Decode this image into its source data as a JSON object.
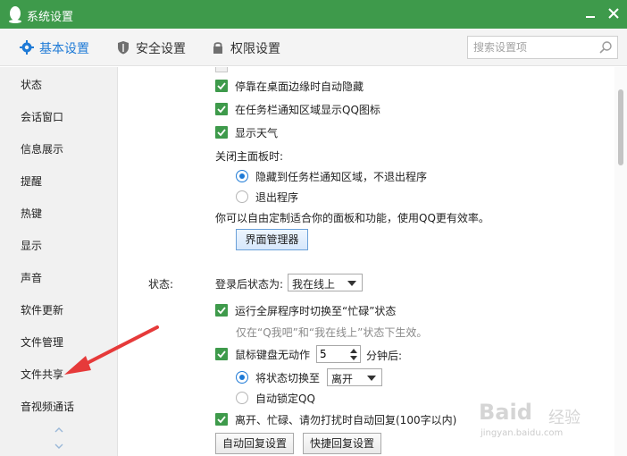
{
  "window": {
    "title": "系统设置"
  },
  "tabs": [
    {
      "label": "基本设置",
      "icon": "gear-icon",
      "active": true
    },
    {
      "label": "安全设置",
      "icon": "shield-icon",
      "active": false
    },
    {
      "label": "权限设置",
      "icon": "lock-icon",
      "active": false
    }
  ],
  "search": {
    "placeholder": "搜索设置项"
  },
  "sidebar": {
    "items": [
      {
        "label": "状态"
      },
      {
        "label": "会话窗口"
      },
      {
        "label": "信息展示"
      },
      {
        "label": "提醒"
      },
      {
        "label": "热键"
      },
      {
        "label": "显示"
      },
      {
        "label": "声音"
      },
      {
        "label": "软件更新"
      },
      {
        "label": "文件管理"
      },
      {
        "label": "文件共享"
      },
      {
        "label": "音视频通话"
      }
    ]
  },
  "panel": {
    "auto_hide": "停靠在桌面边缘时自动隐藏",
    "tray_icon": "在任务栏通知区域显示QQ图标",
    "show_weather": "显示天气",
    "close_panel_label": "关闭主面板时:",
    "close_opt_hide": "隐藏到任务栏通知区域，不退出程序",
    "close_opt_exit": "退出程序",
    "customize_text": "你可以自由定制适合你的面板和功能，使用QQ更有效率。",
    "ui_manager_button": "界面管理器"
  },
  "status": {
    "section_label": "状态:",
    "login_status_label": "登录后状态为:",
    "login_status_value": "我在线上",
    "fullscreen_busy": "运行全屏程序时切换至“忙碌”状态",
    "fullscreen_note": "仅在“Q我吧”和“我在线上”状态下生效。",
    "idle_prefix": "鼠标键盘无动作",
    "idle_minutes": "5",
    "idle_suffix": "分钟后:",
    "switch_status_label": "将状态切换至",
    "switch_status_value": "离开",
    "auto_lock": "自动锁定QQ",
    "auto_reply": "离开、忙碌、请勿打扰时自动回复(100字以内)",
    "auto_reply_button": "自动回复设置",
    "quick_reply_button": "快捷回复设置"
  },
  "watermark": {
    "text1": "Baid",
    "text2": "经验",
    "url": "jingyan.baidu.com"
  },
  "colors": {
    "titlebar": "#3e9a4b",
    "accent": "#1e7ad6",
    "checkbox": "#3e9a4b",
    "arrow": "#e63a3a"
  }
}
